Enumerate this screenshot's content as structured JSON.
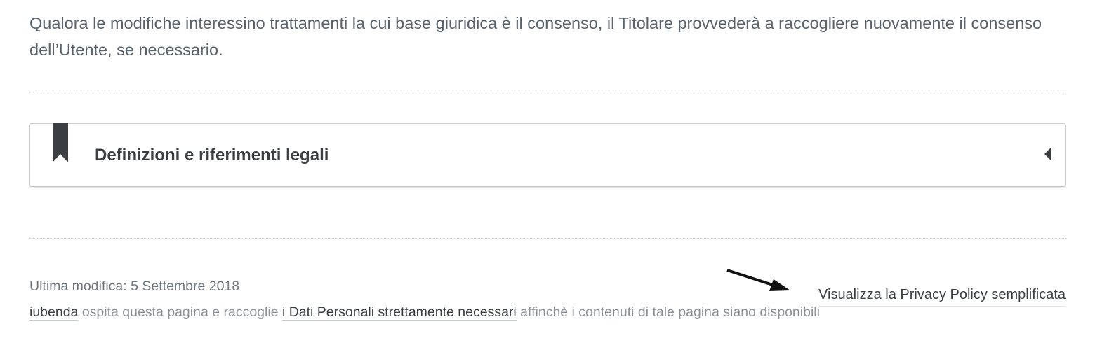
{
  "intro": {
    "text": "Qualora le modifiche interessino trattamenti la cui base giuridica è il consenso, il Titolare provvederà a raccogliere nuovamente il consenso dell’Utente, se necessario."
  },
  "accordion": {
    "title": "Definizioni e riferimenti legali",
    "expanded": false,
    "icons": {
      "left": "bookmark-icon",
      "right": "caret-left-icon"
    }
  },
  "footer": {
    "last_modified": "Ultima modifica: 5 Settembre 2018",
    "simplified_link": "Visualizza la Privacy Policy semplificata",
    "arrow_icon": "arrow-right-icon",
    "host": {
      "link_iubenda": "iubenda",
      "text_1": " ospita questa pagina e raccoglie ",
      "link_data": "i Dati Personali strettamente necessari",
      "text_2": " affinchè i contenuti di tale pagina siano disponibili"
    }
  },
  "colors": {
    "body_text": "#59636d",
    "heading": "#3b3f42",
    "muted": "#8b9299",
    "border": "#c9cdd1"
  }
}
